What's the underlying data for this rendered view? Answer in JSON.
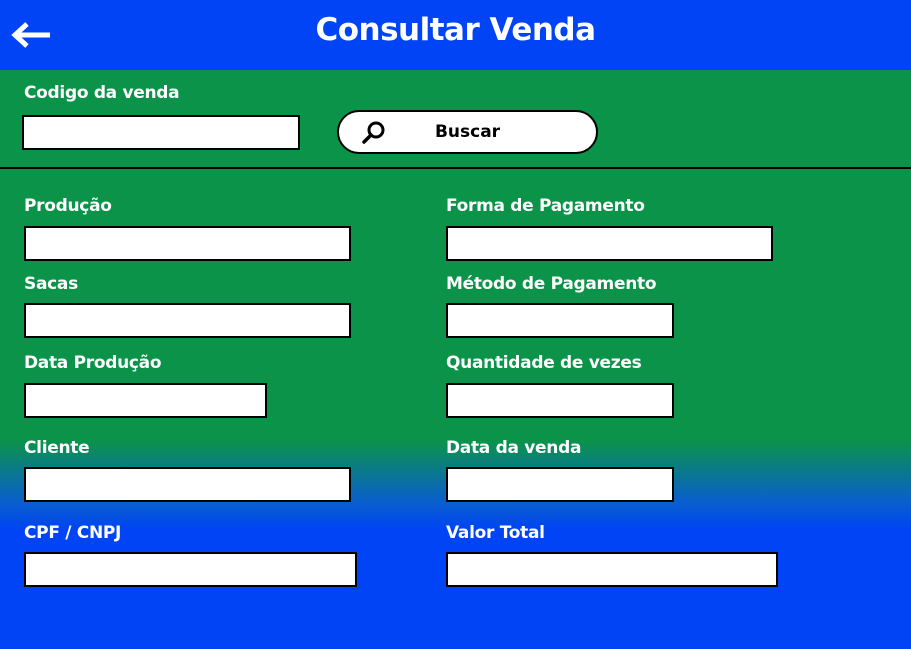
{
  "header": {
    "title": "Consultar Venda",
    "back_icon": "arrow-left-icon"
  },
  "search": {
    "code_label": "Codigo da venda",
    "code_value": "",
    "button_label": "Buscar",
    "button_icon": "search-icon"
  },
  "form": {
    "producao": {
      "label": "Produção",
      "value": ""
    },
    "sacas": {
      "label": "Sacas",
      "value": ""
    },
    "data_producao": {
      "label": "Data Produção",
      "value": ""
    },
    "cliente": {
      "label": "Cliente",
      "value": ""
    },
    "cpf_cnpj": {
      "label": "CPF / CNPJ",
      "value": ""
    },
    "forma_pagamento": {
      "label": "Forma de Pagamento",
      "value": ""
    },
    "metodo_pagamento": {
      "label": "Método de Pagamento",
      "value": ""
    },
    "quantidade_vezes": {
      "label": "Quantidade de vezes",
      "value": ""
    },
    "data_venda": {
      "label": "Data da venda",
      "value": ""
    },
    "valor_total": {
      "label": "Valor Total",
      "value": ""
    }
  },
  "colors": {
    "header": "#0044f5",
    "green": "#0b9349",
    "blue": "#0044f5"
  }
}
